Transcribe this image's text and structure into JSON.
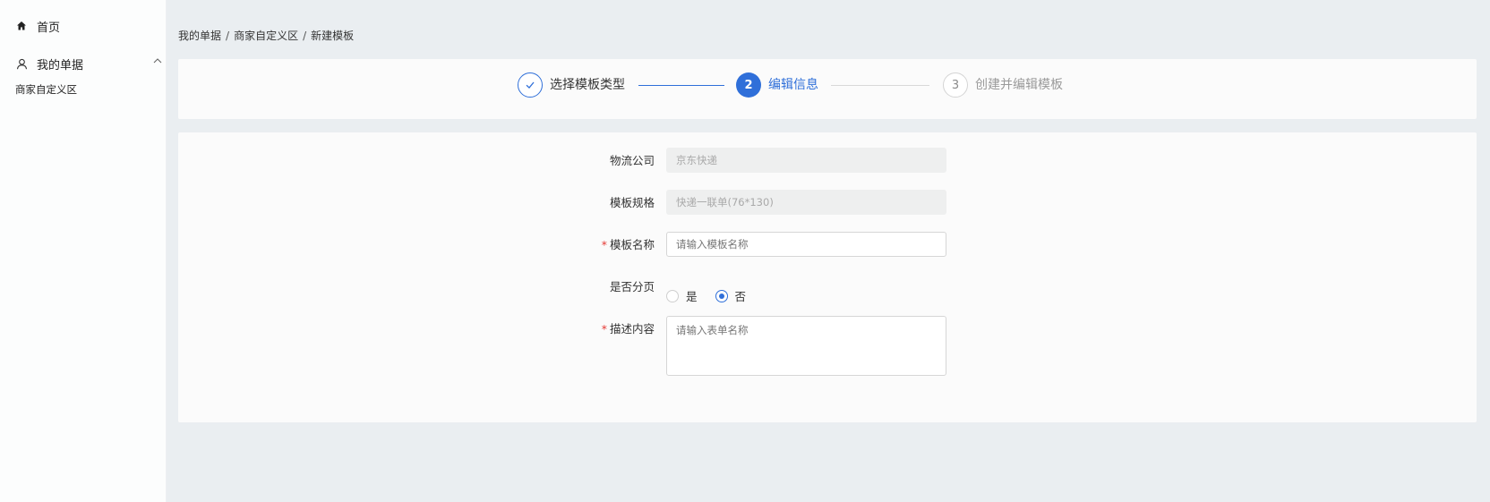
{
  "sidebar": {
    "home_label": "首页",
    "orders_label": "我的单据",
    "sub_item_label": "商家自定义区"
  },
  "breadcrumb": {
    "items": [
      "我的单据",
      "商家自定义区",
      "新建模板"
    ],
    "separator": "/"
  },
  "steps": {
    "step1": {
      "number": "1",
      "label": "选择模板类型",
      "status": "done"
    },
    "step2": {
      "number": "2",
      "label": "编辑信息",
      "status": "active"
    },
    "step3": {
      "number": "3",
      "label": "创建并编辑模板",
      "status": "wait"
    }
  },
  "form": {
    "logistics": {
      "label": "物流公司",
      "value": "京东快递",
      "disabled": true
    },
    "spec": {
      "label": "模板规格",
      "value": "快递一联单(76*130)",
      "disabled": true
    },
    "name": {
      "label": "模板名称",
      "required_mark": "*",
      "placeholder": "请输入模板名称",
      "value": ""
    },
    "paging": {
      "label": "是否分页",
      "option_yes": "是",
      "option_no": "否",
      "selected": "否"
    },
    "description": {
      "label": "描述内容",
      "required_mark": "*",
      "placeholder": "请输入表单名称",
      "value": ""
    }
  },
  "colors": {
    "accent": "#2f6fd9",
    "required": "#e53935",
    "background": "#eaeef1"
  }
}
